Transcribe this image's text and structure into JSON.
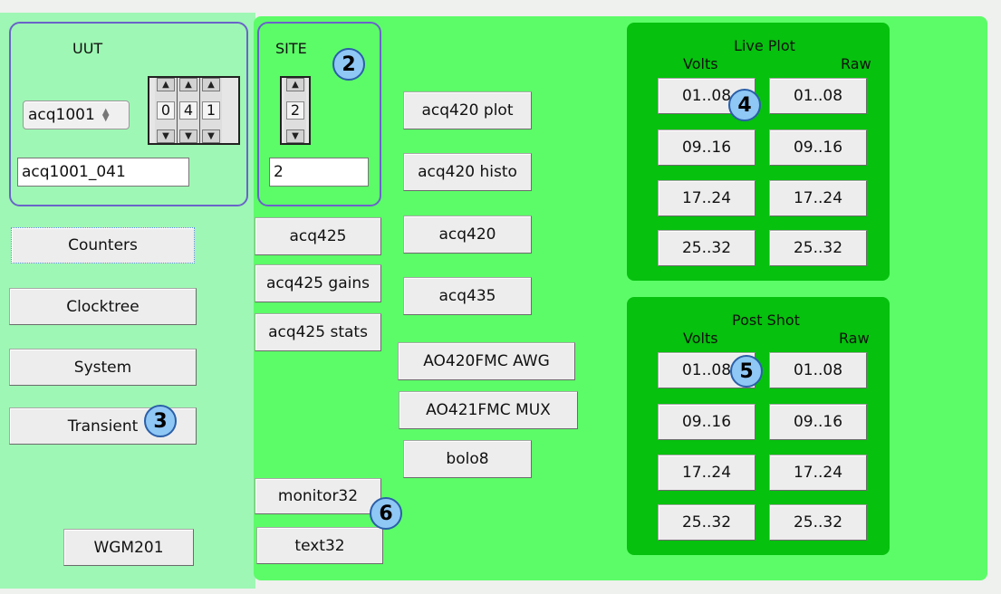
{
  "uut": {
    "title": "UUT",
    "combo_value": "acq1001",
    "spinner_digits": [
      "0",
      "4",
      "1"
    ],
    "name_field": "acq1001_041"
  },
  "site": {
    "title": "SITE",
    "spinner_digit": "2",
    "field": "2"
  },
  "left_buttons": {
    "counters": "Counters",
    "clocktree": "Clocktree",
    "system": "System",
    "transient": "Transient",
    "wgm201": "WGM201"
  },
  "mid_buttons": {
    "acq425": "acq425",
    "acq425_gains": "acq425 gains",
    "acq425_stats": "acq425 stats",
    "monitor32": "monitor32",
    "text32": "text32",
    "acq420_plot": "acq420 plot",
    "acq420_histo": "acq420 histo",
    "acq420": "acq420",
    "acq435": "acq435",
    "ao420fmc_awg": "AO420FMC AWG",
    "ao421fmc_mux": "AO421FMC MUX",
    "bolo8": "bolo8"
  },
  "live_plot": {
    "title": "Live Plot",
    "volts": "Volts",
    "raw": "Raw",
    "volts_buttons": [
      "01..08",
      "09..16",
      "17..24",
      "25..32"
    ],
    "raw_buttons": [
      "01..08",
      "09..16",
      "17..24",
      "25..32"
    ]
  },
  "post_shot": {
    "title": "Post Shot",
    "volts": "Volts",
    "raw": "Raw",
    "volts_buttons": [
      "01..08",
      "09..16",
      "17..24",
      "25..32"
    ],
    "raw_buttons": [
      "01..08",
      "09..16",
      "17..24",
      "25..32"
    ]
  },
  "badges": [
    "2",
    "3",
    "4",
    "5",
    "6"
  ],
  "colors": {
    "left_panel": "#9ef7b4",
    "right_panel": "#5cfc68",
    "plot_box": "#06c10e",
    "group_border": "#6a63c9",
    "badge_fill": "#8fc7f5"
  }
}
